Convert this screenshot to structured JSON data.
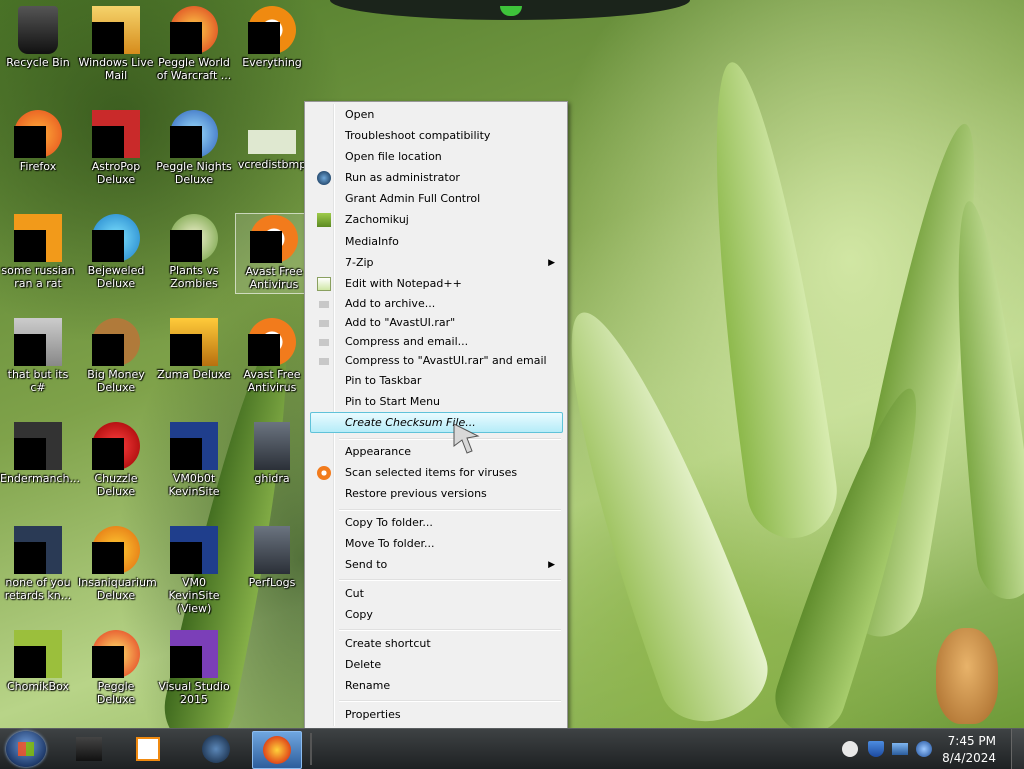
{
  "desktop_icons": [
    {
      "label": "Recycle Bin"
    },
    {
      "label": "Windows Live Mail"
    },
    {
      "label": "Peggle World of Warcraft ..."
    },
    {
      "label": "Everything"
    },
    {
      "label": "Firefox"
    },
    {
      "label": "AstroPop Deluxe"
    },
    {
      "label": "Peggle Nights Deluxe"
    },
    {
      "label": "vcredistbmp"
    },
    {
      "label": "some russian ran a rat"
    },
    {
      "label": "Bejeweled Deluxe"
    },
    {
      "label": "Plants vs Zombies"
    },
    {
      "label": "Avast Free Antivirus"
    },
    {
      "label": "that but its c#"
    },
    {
      "label": "Big Money Deluxe"
    },
    {
      "label": "Zuma Deluxe"
    },
    {
      "label": "Avast Free Antivirus"
    },
    {
      "label": "Endermanch..."
    },
    {
      "label": "Chuzzle Deluxe"
    },
    {
      "label": "VM0b0t KevinSite"
    },
    {
      "label": "ghidra"
    },
    {
      "label": "none of you retards kn..."
    },
    {
      "label": "Insaniquarium Deluxe"
    },
    {
      "label": "VM0 KevinSite (View)"
    },
    {
      "label": "PerfLogs"
    },
    {
      "label": "ChomikBox"
    },
    {
      "label": "Peggle Deluxe"
    },
    {
      "label": "Visual Studio 2015"
    }
  ],
  "context_menu": {
    "items": [
      {
        "label": "Open"
      },
      {
        "label": "Troubleshoot compatibility"
      },
      {
        "label": "Open file location"
      },
      {
        "label": "Run as administrator",
        "icon": "globe-icon"
      },
      {
        "label": "Grant Admin Full Control"
      },
      {
        "label": "Zachomikuj",
        "icon": "hamster-icon"
      },
      {
        "label": "MediaInfo"
      },
      {
        "label": "7-Zip"
      },
      {
        "label": "Edit with Notepad++",
        "icon": "notepad-icon"
      },
      {
        "label": "Add to archive...",
        "icon": "archive-icon"
      },
      {
        "label": "Add to \"AvastUI.rar\"",
        "icon": "archive-icon"
      },
      {
        "label": "Compress and email...",
        "icon": "archive-icon"
      },
      {
        "label": "Compress to \"AvastUI.rar\" and email",
        "icon": "archive-icon"
      },
      {
        "label": "Pin to Taskbar"
      },
      {
        "label": "Pin to Start Menu"
      },
      {
        "label": "Create Checksum File..."
      },
      {
        "label": "Appearance"
      },
      {
        "label": "Scan selected items for viruses",
        "icon": "avast-icon"
      },
      {
        "label": "Restore previous versions"
      },
      {
        "label": "Copy To folder..."
      },
      {
        "label": "Move To folder..."
      },
      {
        "label": "Send to"
      },
      {
        "label": "Cut"
      },
      {
        "label": "Copy"
      },
      {
        "label": "Create shortcut"
      },
      {
        "label": "Delete"
      },
      {
        "label": "Rename"
      },
      {
        "label": "Properties"
      }
    ]
  },
  "taskbar": {
    "clock_time": "7:45 PM",
    "clock_date": "8/4/2024",
    "accent_color": "#1e2123"
  }
}
